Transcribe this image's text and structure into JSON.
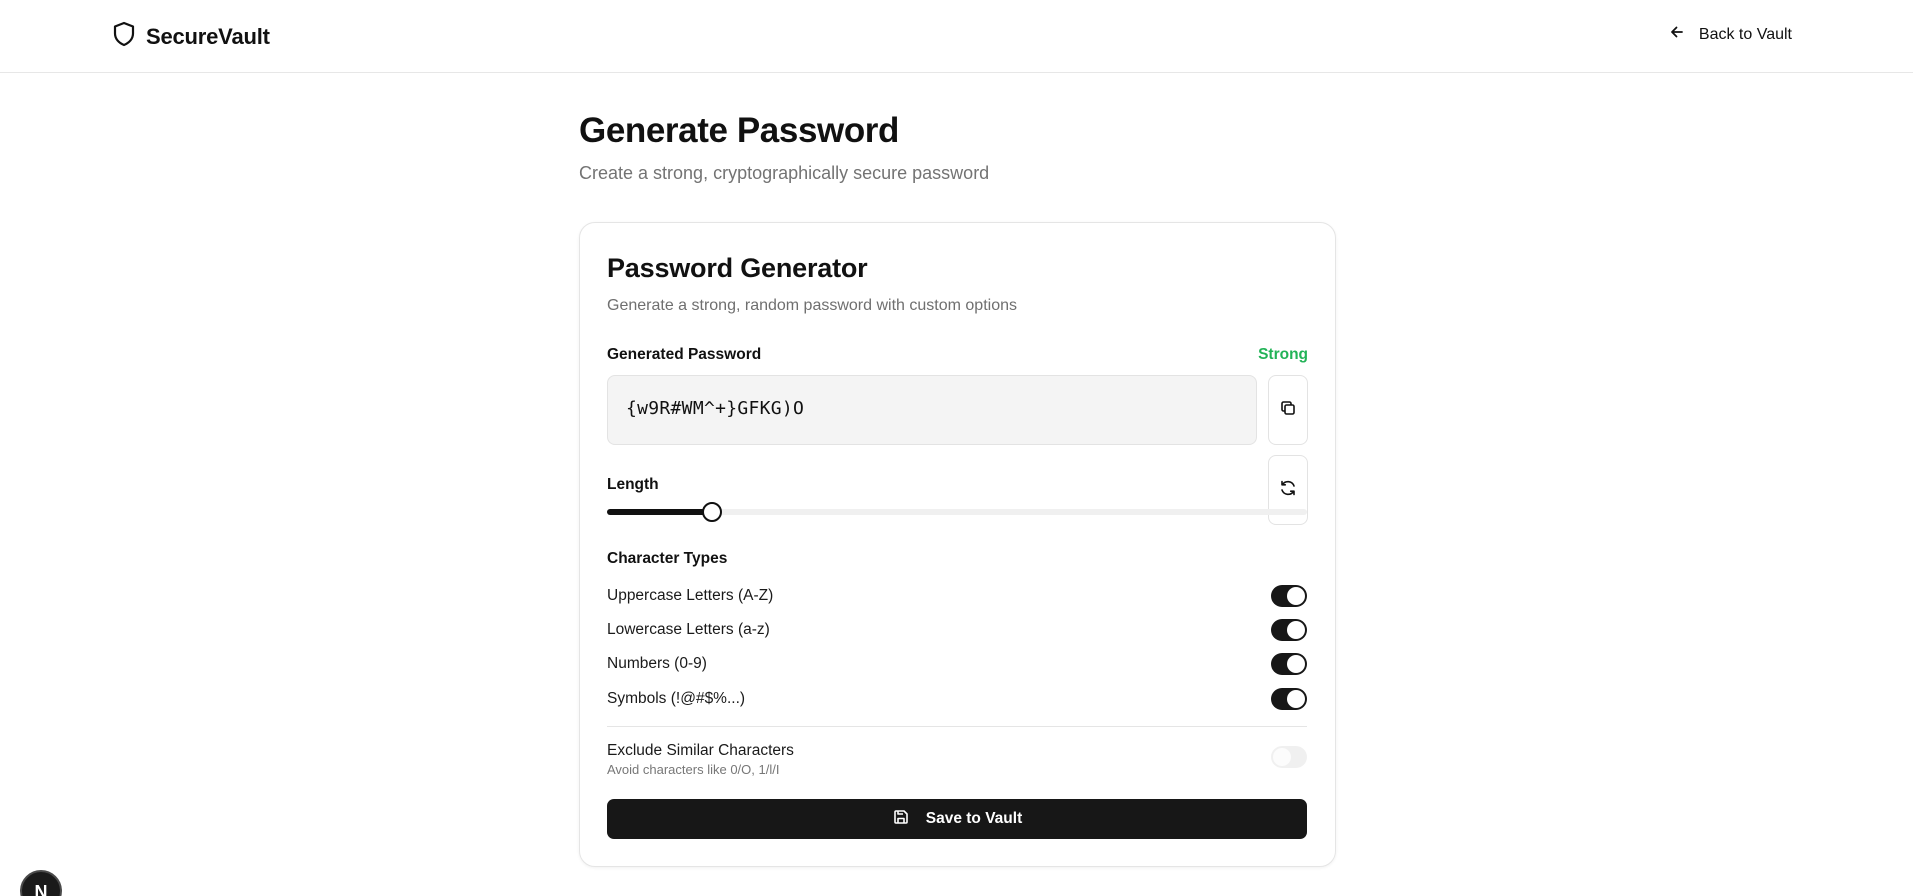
{
  "header": {
    "brand_name": "SecureVault",
    "back_label": "Back to Vault"
  },
  "page": {
    "title": "Generate Password",
    "subtitle": "Create a strong, cryptographically secure password"
  },
  "generator": {
    "title": "Password Generator",
    "description": "Generate a strong, random password with custom options",
    "password_label": "Generated Password",
    "strength": "Strong",
    "password_value": "{w9R#WM^+}GFKG)O",
    "length_label": "Length",
    "length_value": "16",
    "length_fraction": 0.15,
    "char_types_label": "Character Types",
    "options": [
      {
        "label": "Uppercase Letters (A-Z)",
        "enabled": true
      },
      {
        "label": "Lowercase Letters (a-z)",
        "enabled": true
      },
      {
        "label": "Numbers (0-9)",
        "enabled": true
      },
      {
        "label": "Symbols (!@#$%...)",
        "enabled": true
      }
    ],
    "exclude_similar": {
      "label": "Exclude Similar Characters",
      "hint": "Avoid characters like 0/O, 1/l/I",
      "enabled": false
    },
    "save_label": "Save to Vault"
  },
  "avatar_letter": "N",
  "colors": {
    "accent": "#171717",
    "strength": "#22b357",
    "muted": "#737373"
  }
}
